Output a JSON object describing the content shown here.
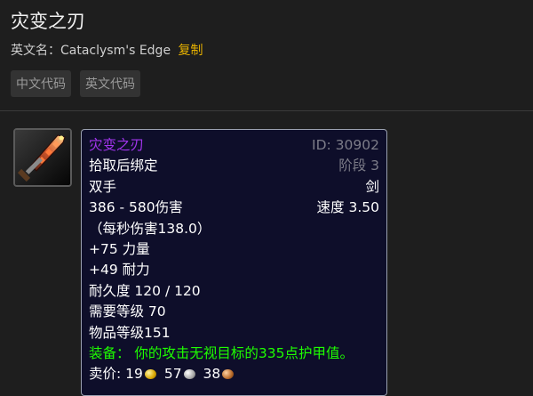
{
  "page": {
    "title": "灾变之刃",
    "english_name_label": "英文名：",
    "english_name_value": "Cataclysm's Edge",
    "copy_label": "复制",
    "tabs": [
      "中文代码",
      "英文代码"
    ]
  },
  "item_icon": {
    "name": "two-handed-sword-icon"
  },
  "tooltip": {
    "name": "灾变之刃",
    "id_text": "ID: 30902",
    "bind": "拾取后绑定",
    "tier_text": "阶段 3",
    "slot": "双手",
    "weapon_type": "剑",
    "damage": "386 - 580伤害",
    "speed": "速度 3.50",
    "dps": "（每秒伤害138.0）",
    "stat_strength": "+75 力量",
    "stat_stamina": "+49 耐力",
    "durability": "耐久度 120 / 120",
    "required_level": "需要等级 70",
    "item_level": "物品等级151",
    "equip_effect": "装备： 你的攻击无视目标的335点护甲值。",
    "sell_label": "卖价:",
    "sell_gold": "19",
    "sell_silver": "57",
    "sell_copper": "38"
  },
  "colors": {
    "item_name_epic": "#a335ee",
    "equip_green": "#1eff00",
    "copy_link": "#e8b200",
    "tooltip_bg": "#0e0e2a"
  }
}
